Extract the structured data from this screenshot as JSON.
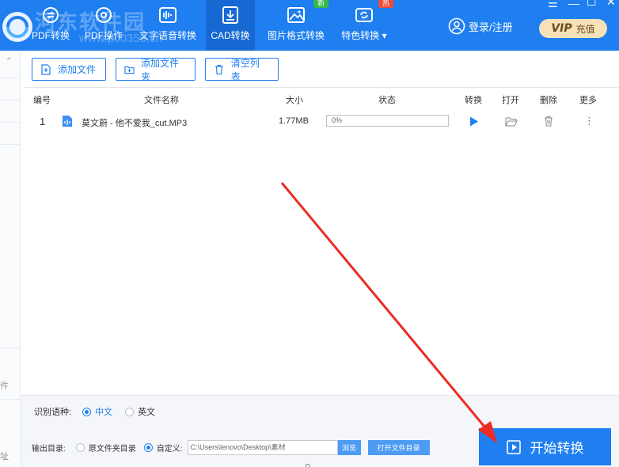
{
  "header": {
    "watermark": "河东软件园",
    "watermark_sub": "www.pc0359.cn",
    "tabs": [
      {
        "label": "PDF转换",
        "icon": "pdf-convert-icon"
      },
      {
        "label": "PDF操作",
        "icon": "pdf-operate-icon"
      },
      {
        "label": "文字语音转换",
        "icon": "audio-wave-icon"
      },
      {
        "label": "CAD转换",
        "icon": "cad-icon"
      },
      {
        "label": "图片格式转换",
        "icon": "image-icon"
      },
      {
        "label": "特色转换",
        "icon": "special-convert-icon"
      }
    ],
    "badge_new": "新",
    "badge_hot": "热",
    "login_label": "登录/注册",
    "vip_label": "VIP",
    "recharge_label": "充值",
    "colors": {
      "primary": "#1f7ff0",
      "active_tab": "#1669d3",
      "new_badge": "#35b84a",
      "hot_badge": "#f04a3a",
      "vip_bg": "#f6e1b8"
    }
  },
  "sidebar": {
    "chars": [
      "件",
      "址"
    ]
  },
  "toolbar": {
    "add_file": "添加文件",
    "add_folder": "添加文件夹",
    "clear_list": "清空列表"
  },
  "table": {
    "headers": {
      "index": "编号",
      "filename": "文件名称",
      "size": "大小",
      "status": "状态",
      "convert": "转换",
      "open": "打开",
      "delete": "删除",
      "more": "更多"
    },
    "rows": [
      {
        "index": "1",
        "filename": "莫文蔚 - 他不爱我_cut.MP3",
        "size": "1.77MB",
        "progress": "0%",
        "progress_value": 0
      }
    ]
  },
  "options": {
    "lang_label": "识别语种:",
    "lang_chinese": "中文",
    "lang_english": "英文",
    "lang_selected": "中文",
    "output_label": "输出目录:",
    "output_original": "原文件夹目录",
    "output_custom": "自定义:",
    "output_selected": "自定义:",
    "output_path": "C:\\Users\\lenovo\\Desktop\\素材",
    "browse": "浏览",
    "open_folder": "打开文件目录"
  },
  "start_button": "开始转换"
}
